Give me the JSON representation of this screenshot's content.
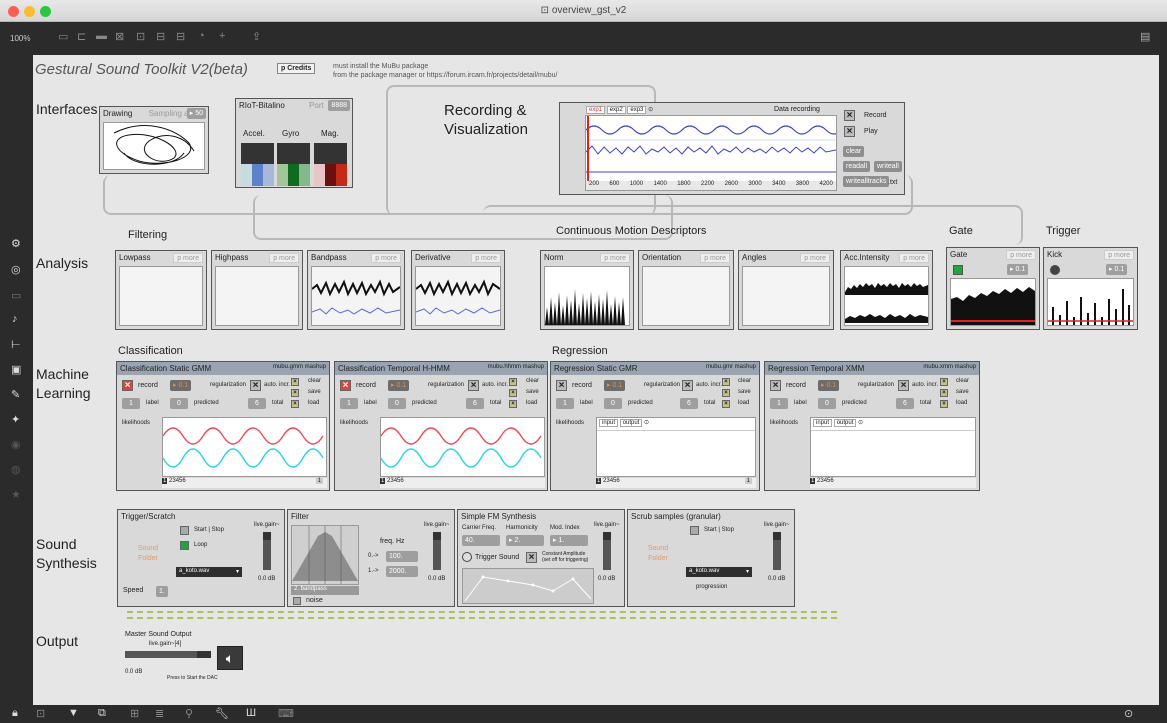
{
  "window": {
    "title": "overview_gst_v2",
    "zoom": "100%"
  },
  "header": {
    "title": "Gestural Sound Toolkit V2(beta)",
    "credits_button": "p Credits",
    "note_line1": "must install  the MuBu package",
    "note_line2": "from the package manager or https://forum.ircam.fr/projects/detail/mubu/"
  },
  "sections": {
    "interfaces": "Interfaces",
    "recording_line1": "Recording &",
    "recording_line2": "Visualization",
    "analysis": "Analysis",
    "ml_line1": "Machine",
    "ml_line2": "Learning",
    "synth_line1": "Sound",
    "synth_line2": "Synthesis",
    "output": "Output"
  },
  "subsections": {
    "filtering": "Filtering",
    "cmd": "Continuous Motion Descriptors",
    "gate": "Gate",
    "trigger": "Trigger",
    "classification": "Classification",
    "regression": "Regression"
  },
  "drawing": {
    "title": "Drawing",
    "sampling": "Sampling at",
    "value": "▸ 50"
  },
  "riot": {
    "title": "RIoT-Bitalino",
    "port_label": "Port",
    "port": "8888",
    "cols": [
      "Accel.",
      "Gyro",
      "Mag."
    ]
  },
  "recording": {
    "tabs": [
      "exp1",
      "exp2",
      "exp3",
      "⊙"
    ],
    "title": "Data recording",
    "record": "Record",
    "play": "Play",
    "clear": "clear",
    "readall": "readall",
    "writeall": "writeall",
    "writealltracks": "writealltracks",
    ".txt": ".txt",
    "ticks": [
      "200",
      "600",
      "1000",
      "1400",
      "1800",
      "2200",
      "2600",
      "3000",
      "3400",
      "3800",
      "4200"
    ]
  },
  "analysis": {
    "modules": [
      "Lowpass",
      "Highpass",
      "Bandpass",
      "Derivative",
      "Norm",
      "Orientation",
      "Angles",
      "Acc.Intensity",
      "Gate",
      "Kick"
    ],
    "pmore": "p more",
    "val": "▸ 0.1"
  },
  "ml": {
    "modules": [
      {
        "title": "Classification Static GMM",
        "tag": "mubu.gmm mashup"
      },
      {
        "title": "Classification Temporal H-HMM",
        "tag": "mubu.hhmm mashup"
      },
      {
        "title": "Regression Static GMR",
        "tag": "mubu.gmr mashup"
      },
      {
        "title": "Regression Temporal XMM",
        "tag": "mubu.xmm mashup"
      }
    ],
    "record": "record",
    "reg_val": "▸ 0.1",
    "regularization": "regularization",
    "autoinc": "auto. incr.",
    "clear": "clear",
    "save": "save",
    "load": "load",
    "label_num": "1",
    "label": "label",
    "pred_num": "0",
    "predicted": "predicted",
    "total_num": "6",
    "total": "total",
    "likelihoods": "likelihoods",
    "tabs": [
      "input",
      "output",
      "⊙"
    ],
    "pages": [
      "1",
      "2",
      "3",
      "4",
      "5",
      "6"
    ],
    "page_end": "1"
  },
  "synth": {
    "trigger": {
      "title": "Trigger/Scratch",
      "startstop": "Start | Stop",
      "loop": "Loop",
      "sound_folder": "Sound Folder",
      "file": "a_koto.wav",
      "speed_label": "Speed",
      "speed": "1.",
      "gain": "live.gain~",
      "db": "0.0 dB"
    },
    "filter": {
      "title": "Filter",
      "freq": "freq. Hz",
      "r1": "0.->",
      "v1": "100.",
      "r2": "1.->",
      "v2": "2000.",
      "mode": "2. bandpass",
      "noise": "noise",
      "gain": "live.gain~",
      "db": "0.0 dB"
    },
    "fm": {
      "title": "Simple FM Synthesis",
      "carrier": "Carrier Freq.",
      "harmonicity": "Harmonicity",
      "modindex": "Mod. Index",
      "cv": "40.",
      "hv": "▸ 2.",
      "mv": "▸ 1.",
      "trigger": "Trigger Sound",
      "const": "Constant Amplitude",
      "const2": "(set off for triggering)",
      "gain": "live.gain~",
      "db": "0.0 dB"
    },
    "scrub": {
      "title": "Scrub samples (granular)",
      "startstop": "Start | Stop",
      "sound_folder": "Sound Folder",
      "file": "a_koto.wav",
      "progression": "progression",
      "gain": "live.gain~",
      "db": "0.0 dB"
    }
  },
  "output": {
    "master": "Master Sound Output",
    "gain": "live.gain~[4]",
    "db": "0.0 dB",
    "dac": "Press to Start the DAC"
  },
  "colors": {
    "toolbar": "#2b2b2b",
    "canvas": "#e6e6e6",
    "red": "#e0413a",
    "green": "#1fa53a"
  }
}
